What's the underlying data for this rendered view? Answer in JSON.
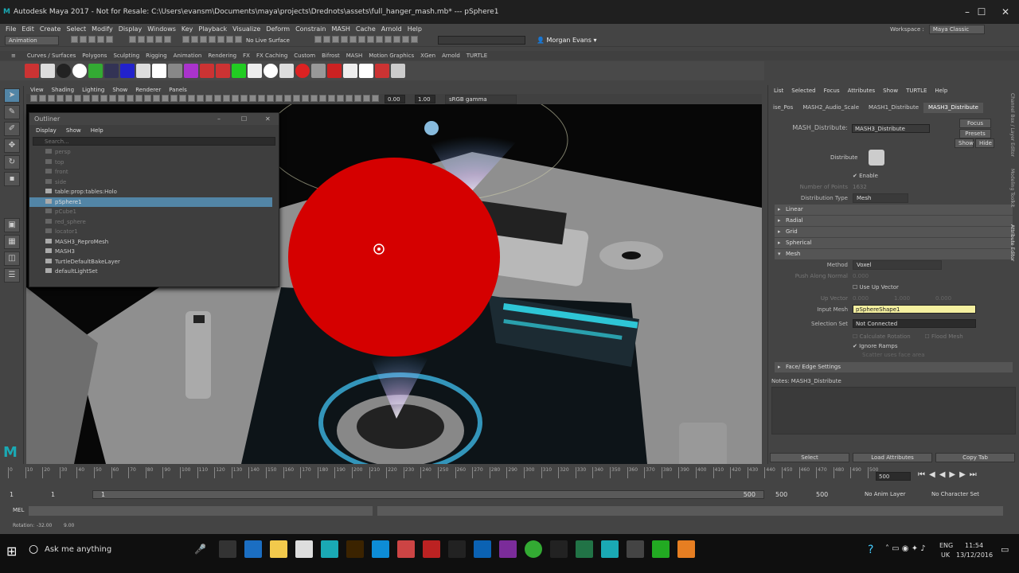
{
  "window": {
    "title": "Autodesk Maya 2017 - Not for Resale: C:\\Users\\evansm\\Documents\\maya\\projects\\Drednots\\assets\\full_hanger_mash.mb* --- pSphere1"
  },
  "menubar": [
    "File",
    "Edit",
    "Create",
    "Select",
    "Modify",
    "Display",
    "Windows",
    "Key",
    "Playback",
    "Visualize",
    "Deform",
    "Constrain",
    "MASH",
    "Cache",
    "Arnold",
    "Help"
  ],
  "workspace": {
    "label": "Workspace :",
    "value": "Maya Classic"
  },
  "statusline": {
    "mode": "Animation",
    "live_surface": "No Live Surface",
    "user": "Morgan Evans"
  },
  "shelf_tabs": [
    "Curves / Surfaces",
    "Polygons",
    "Sculpting",
    "Rigging",
    "Animation",
    "Rendering",
    "FX",
    "FX Caching",
    "Custom",
    "Bifrost",
    "MASH",
    "Motion Graphics",
    "XGen",
    "Arnold",
    "TURTLE"
  ],
  "viewport": {
    "menu": [
      "View",
      "Shading",
      "Lighting",
      "Show",
      "Renderer",
      "Panels"
    ],
    "field1": "0.00",
    "field2": "1.00",
    "color_space": "sRGB gamma"
  },
  "outliner": {
    "title": "Outliner",
    "menu": [
      "Display",
      "Show",
      "Help"
    ],
    "search_placeholder": "Search...",
    "items": [
      {
        "label": "persp",
        "dim": true
      },
      {
        "label": "top",
        "dim": true
      },
      {
        "label": "front",
        "dim": true
      },
      {
        "label": "side",
        "dim": true
      },
      {
        "label": "table:prop:tables:Holo",
        "dim": false
      },
      {
        "label": "pSphere1",
        "dim": false,
        "selected": true
      },
      {
        "label": "pCube1",
        "dim": true
      },
      {
        "label": "red_sphere",
        "dim": true
      },
      {
        "label": "locator1",
        "dim": true
      },
      {
        "label": "MASH3_ReproMesh",
        "dim": false
      },
      {
        "label": "MASH3",
        "dim": false
      },
      {
        "label": "TurtleDefaultBakeLayer",
        "dim": false
      },
      {
        "label": "defaultLightSet",
        "dim": false
      }
    ]
  },
  "attr_editor": {
    "menu": [
      "List",
      "Selected",
      "Focus",
      "Attributes",
      "Show",
      "TURTLE",
      "Help"
    ],
    "tabs": [
      "ise_Pos",
      "MASH2_Audio_Scale",
      "MASH1_Distribute",
      "MASH3_Distribute"
    ],
    "node_label": "MASH_Distribute:",
    "node_value": "MASH3_Distribute",
    "buttons": [
      "Focus",
      "Presets",
      "Show",
      "Hide"
    ],
    "header": "Distribute",
    "enable": "Enable",
    "num_points_label": "Number of Points",
    "num_points": "1632",
    "dist_type_label": "Distribution Type",
    "dist_type": "Mesh",
    "frames": [
      "Linear",
      "Radial",
      "Grid",
      "Spherical",
      "Mesh"
    ],
    "method_label": "Method",
    "method": "Voxel",
    "push_label": "Push Along Normal",
    "push_value": "0.000",
    "use_up_vector": "Use Up Vector",
    "up_vector_label": "Up Vector",
    "up_vector": [
      "0.000",
      "1.000",
      "0.000"
    ],
    "input_mesh_label": "Input Mesh",
    "input_mesh": "pSphereShape1",
    "selection_set_label": "Selection Set",
    "selection_set": "Not Connected",
    "calc_rotation": "Calculate Rotation",
    "flood_mesh": "Flood Mesh",
    "ignore_ramps": "Ignore Ramps",
    "scatter_face_area": "Scatter uses face area",
    "face_edge_frame": "Face/ Edge Settings",
    "notes": "Notes:  MASH3_Distribute",
    "bottom_buttons": [
      "Select",
      "Load Attributes",
      "Copy Tab"
    ]
  },
  "side_tabs": [
    "Channel Box / Layer Editor",
    "Modeling Toolkit",
    "Attribute Editor"
  ],
  "timeline": {
    "ticks": [
      "0",
      "10",
      "20",
      "30",
      "40",
      "50",
      "60",
      "70",
      "80",
      "90",
      "100",
      "110",
      "120",
      "130",
      "140",
      "150",
      "160",
      "170",
      "180",
      "190",
      "200",
      "210",
      "220",
      "230",
      "240",
      "250",
      "260",
      "270",
      "280",
      "290",
      "300",
      "310",
      "320",
      "330",
      "340",
      "350",
      "360",
      "370",
      "380",
      "390",
      "400",
      "410",
      "420",
      "430",
      "440",
      "450",
      "460",
      "470",
      "480",
      "490",
      "500"
    ],
    "current_frame": "500",
    "range_start": "1",
    "range_start2": "1",
    "range_slider_start": "1",
    "range_slider_end": "500",
    "range_end": "500",
    "range_end2": "500",
    "anim_layer": "No Anim Layer",
    "char_set": "No Character Set"
  },
  "cmdline": {
    "label": "MEL"
  },
  "helpline": {
    "label": "Rotation:",
    "v1": "-32.00",
    "v2": "9.00"
  },
  "taskbar": {
    "search": "Ask me anything",
    "lang1": "ENG",
    "lang2": "UK",
    "time": "11:54",
    "date": "13/12/2016"
  }
}
